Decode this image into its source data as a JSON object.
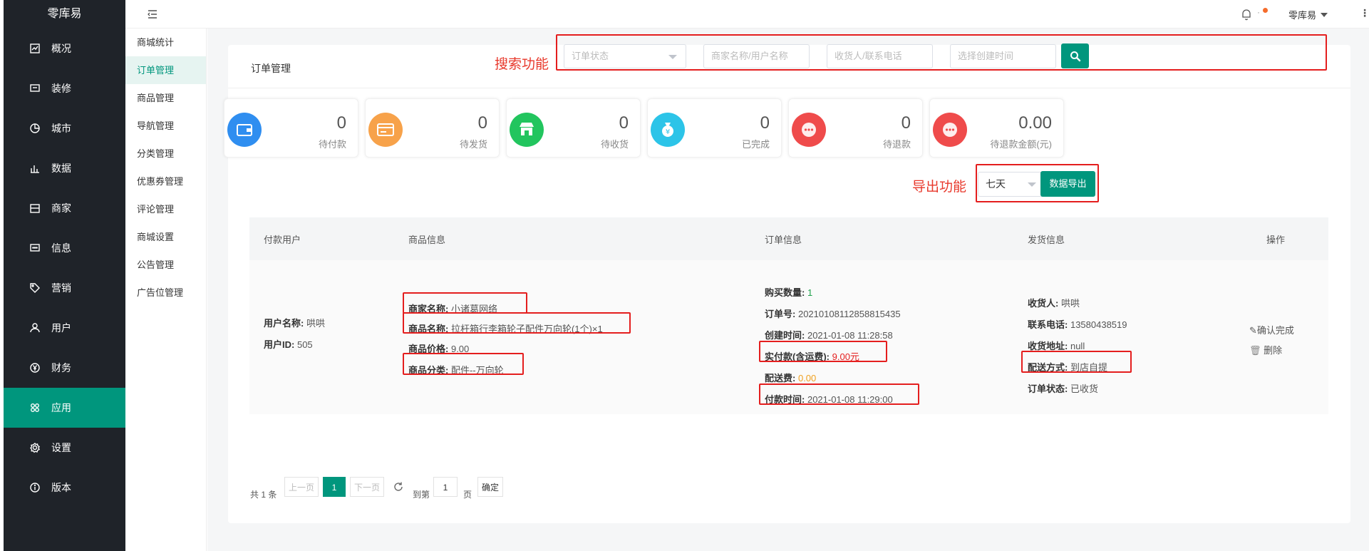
{
  "app": {
    "brand": "零库易"
  },
  "sidebar": {
    "items": [
      {
        "label": "概况",
        "icon": "dashboard-icon"
      },
      {
        "label": "装修",
        "icon": "chat-icon"
      },
      {
        "label": "城市",
        "icon": "pie-icon"
      },
      {
        "label": "数据",
        "icon": "bar-chart-icon"
      },
      {
        "label": "商家",
        "icon": "store-icon"
      },
      {
        "label": "信息",
        "icon": "message-icon"
      },
      {
        "label": "营销",
        "icon": "tag-icon"
      },
      {
        "label": "用户",
        "icon": "user-icon"
      },
      {
        "label": "财务",
        "icon": "yen-icon"
      },
      {
        "label": "应用",
        "icon": "apps-icon",
        "active": true
      },
      {
        "label": "设置",
        "icon": "gear-icon"
      },
      {
        "label": "版本",
        "icon": "info-icon"
      }
    ]
  },
  "subnav": {
    "items": [
      "商城统计",
      "订单管理",
      "商品管理",
      "导航管理",
      "分类管理",
      "优惠券管理",
      "评论管理",
      "商城设置",
      "公告管理",
      "广告位管理"
    ],
    "active": "订单管理"
  },
  "topbar": {
    "user": "零库易",
    "notify_sep": "·"
  },
  "page": {
    "title": "订单管理"
  },
  "annotations": {
    "search": "搜索功能",
    "export": "导出功能"
  },
  "filters": {
    "status_placeholder": "订单状态",
    "merchant_placeholder": "商家名称/用户名称",
    "receiver_placeholder": "收货人/联系电话",
    "date_placeholder": "选择创建时间"
  },
  "stats": [
    {
      "value": "0",
      "label": "待付款",
      "color": "#2f8ef0",
      "icon": "wallet-icon"
    },
    {
      "value": "0",
      "label": "待发货",
      "color": "#f7a24a",
      "icon": "card-icon"
    },
    {
      "value": "0",
      "label": "待收货",
      "color": "#22c55e",
      "icon": "shop-icon"
    },
    {
      "value": "0",
      "label": "已完成",
      "color": "#2cc4e8",
      "icon": "money-bag-icon"
    },
    {
      "value": "0",
      "label": "待退款",
      "color": "#ef4b4b",
      "icon": "dots-icon"
    },
    {
      "value": "0.00",
      "label": "待退款金额(元)",
      "color": "#ef4b4b",
      "icon": "dots-icon"
    }
  ],
  "export": {
    "range": "七天",
    "button": "数据导出"
  },
  "table": {
    "headers": [
      "付款用户",
      "商品信息",
      "订单信息",
      "发货信息",
      "操作"
    ],
    "row": {
      "user_name_label": "用户名称:",
      "user_name": "哄哄",
      "user_id_label": "用户ID:",
      "user_id": "505",
      "merchant_label": "商家名称:",
      "merchant": "小诸葛网络",
      "product_label": "商品名称:",
      "product": "拉杆箱行李箱轮子配件万向轮(1个)×1",
      "price_label": "商品价格:",
      "price": "9.00",
      "category_label": "商品分类:",
      "category": "配件--万向轮",
      "qty_label": "购买数量:",
      "qty": "1",
      "order_no_label": "订单号:",
      "order_no": "20210108112858815435",
      "created_label": "创建时间:",
      "created": "2021-01-08 11:28:58",
      "paid_label": "实付款(含运费):",
      "paid": "9.00元",
      "shipping_fee_label": "配送费:",
      "shipping_fee": "0.00",
      "pay_time_label": "付款时间:",
      "pay_time": "2021-01-08 11:29:00",
      "receiver_label": "收货人:",
      "receiver": "哄哄",
      "phone_label": "联系电话:",
      "phone": "13580438519",
      "address_label": "收货地址:",
      "address": "null",
      "delivery_label": "配送方式:",
      "delivery": "到店自提",
      "status_label": "订单状态:",
      "status": "已收货",
      "action_confirm": "确认完成",
      "action_delete": "删除"
    }
  },
  "pagination": {
    "total": "共 1 条",
    "prev": "上一页",
    "current": "1",
    "next": "下一页",
    "goto_label": "到第",
    "goto_value": "1",
    "page_unit": "页",
    "confirm": "确定"
  },
  "colors": {
    "accent": "#00967d",
    "sidebar_bg": "#1f2329",
    "annotation_red": "#e41e1e"
  }
}
